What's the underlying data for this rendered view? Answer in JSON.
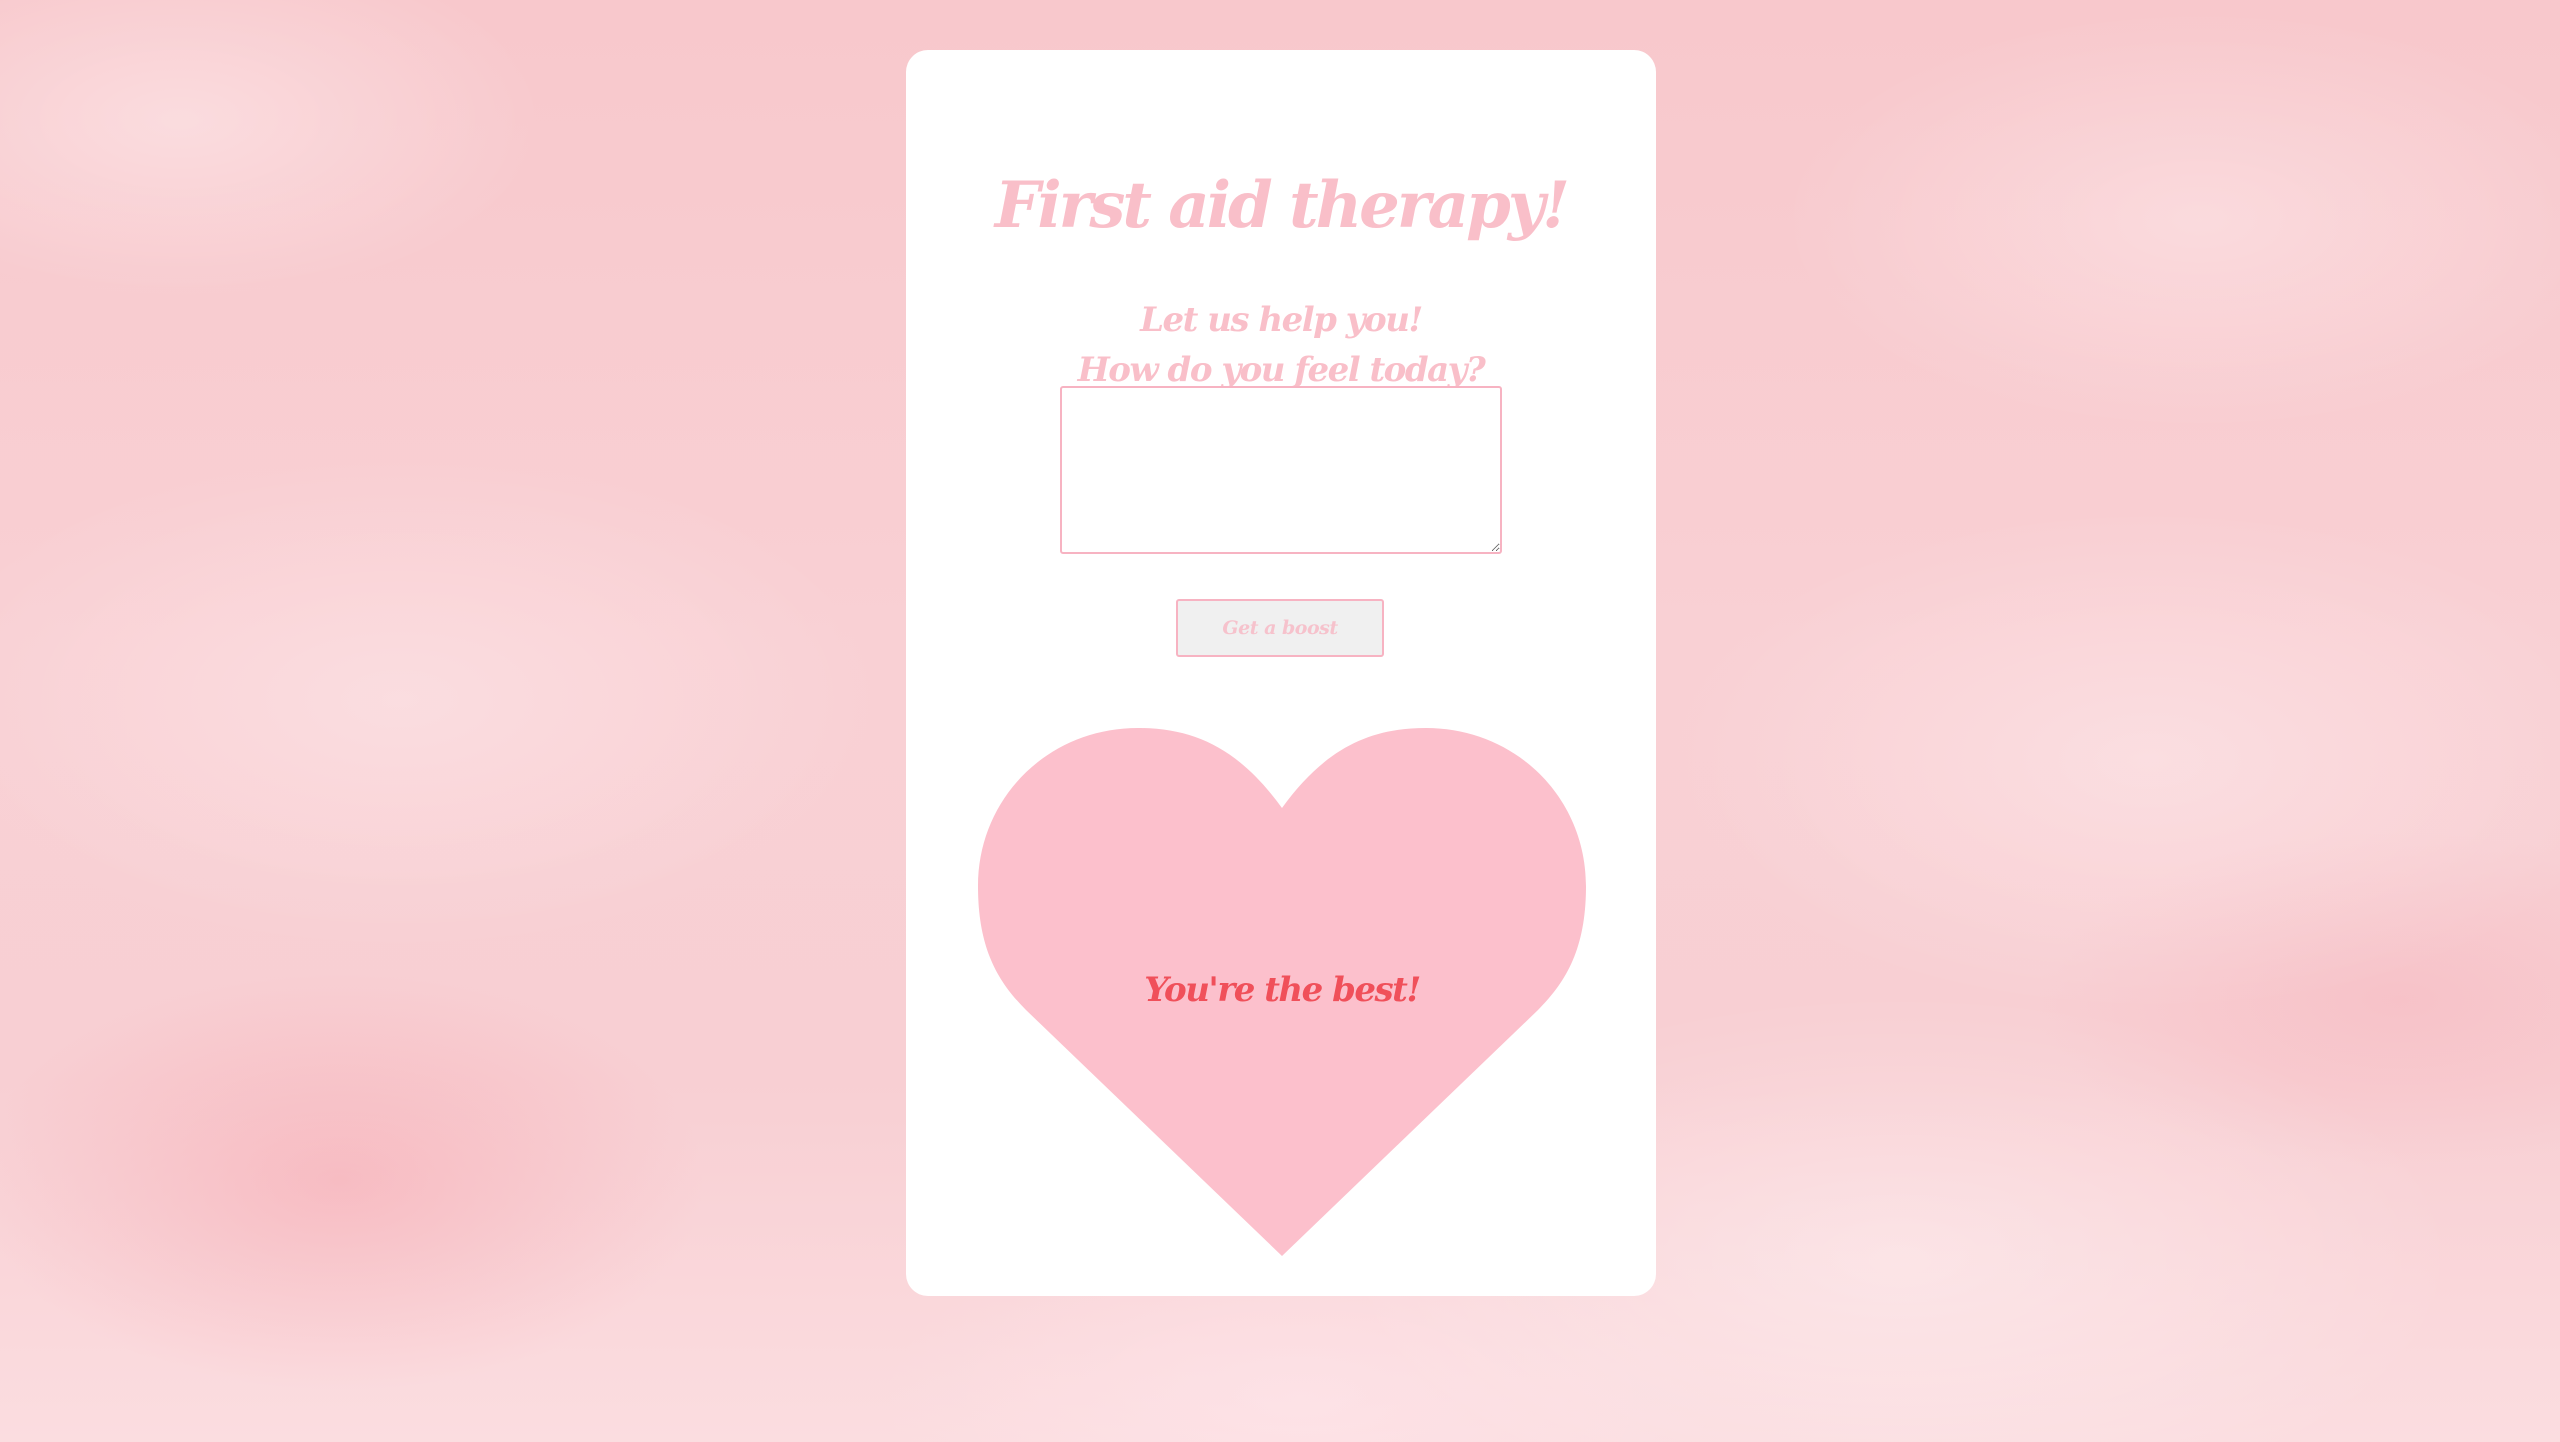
{
  "card": {
    "title": "First aid therapy!",
    "subtitle_line1": "Let us help you!",
    "subtitle_line2": "How do you feel today?",
    "feelings_input": {
      "value": "",
      "placeholder": ""
    },
    "boost_button_label": "Get a boost",
    "heart_message": "You're the best!"
  },
  "colors": {
    "accent_pink": "#f9bfc9",
    "heart_fill": "#fcc0cc",
    "message_red": "#f0505a",
    "background_cloud": "#f8c8cc",
    "card_bg": "#ffffff"
  }
}
